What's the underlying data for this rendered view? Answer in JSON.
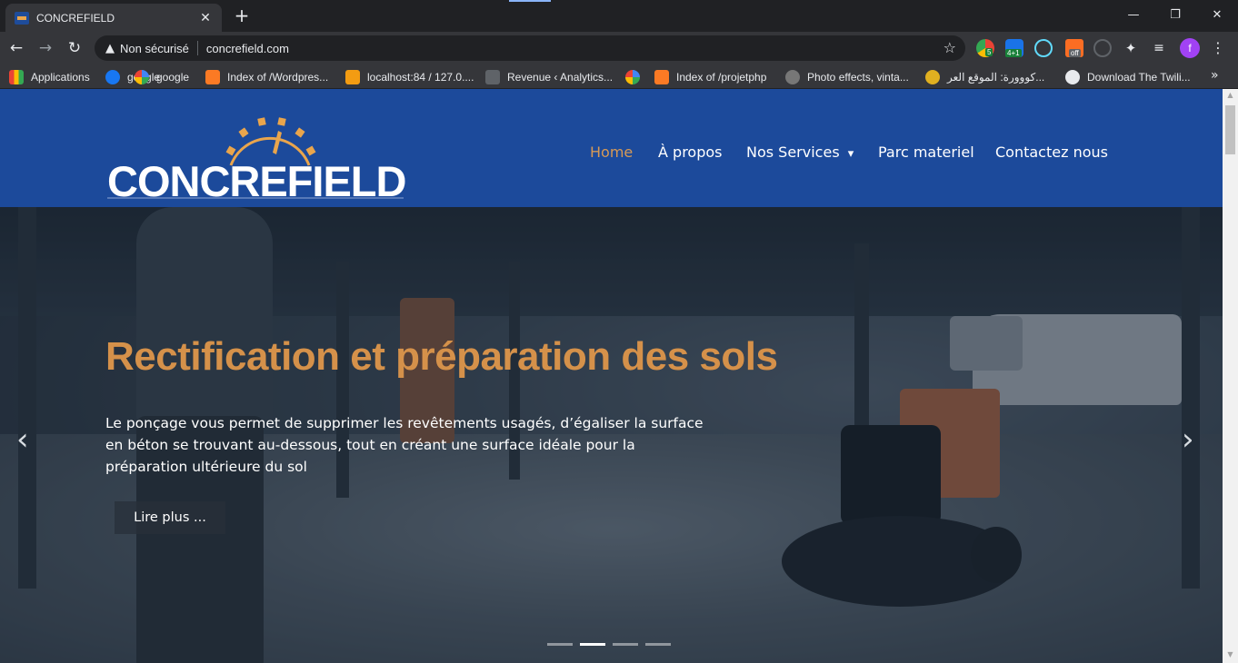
{
  "browser": {
    "tab": {
      "title": "CONCREFIELD",
      "close_glyph": "✕",
      "favicon": "concrefield-favicon"
    },
    "new_tab_glyph": "+",
    "window_controls": {
      "minimize": "—",
      "maximize": "❐",
      "close": "✕"
    },
    "toolbar": {
      "back_glyph": "←",
      "forward_glyph": "→",
      "reload_glyph": "↻",
      "security_label": "Non sécurisé",
      "url": "concrefield.com",
      "star_glyph": "☆",
      "ext_badges": [
        "5",
        "4+1",
        "off"
      ],
      "profile_initial": "f",
      "menu_glyph": "⋮"
    },
    "bookmarks": [
      {
        "label": "Applications",
        "icon": "apps-grid-icon",
        "color": "#e8453c"
      },
      {
        "label": "google",
        "icon": "facebook-icon",
        "color": "#1877f2"
      },
      {
        "label": "google",
        "icon": "google-icon",
        "color": "#ffffff"
      },
      {
        "label": "Index of /Wordpres...",
        "icon": "xampp-icon",
        "color": "#fb7a24"
      },
      {
        "label": "localhost:84 / 127.0....",
        "icon": "phpmyadmin-icon",
        "color": "#f39c12"
      },
      {
        "label": "Revenue ‹ Analytics...",
        "icon": "bag-icon",
        "color": "#5f6368"
      },
      {
        "label": "Index of /projetphp",
        "icon": "xampp-icon",
        "color": "#fb7a24"
      },
      {
        "label": "Photo effects, vinta...",
        "icon": "photo-icon",
        "color": "#777777"
      },
      {
        "label": "كووورة: الموقع العر...",
        "icon": "kooora-icon",
        "color": "#e0b020"
      },
      {
        "label": "Download The Twili...",
        "icon": "globe-icon",
        "color": "#e8eaed"
      }
    ],
    "bookmarks_more": "»"
  },
  "site": {
    "logo_text": "CONCREFIELD",
    "nav": [
      {
        "label": "Home",
        "active": true
      },
      {
        "label": "À propos",
        "active": false
      },
      {
        "label": "Nos Services",
        "active": false,
        "dropdown": true
      },
      {
        "label": "Parc materiel",
        "active": false
      },
      {
        "label": "Contactez nous",
        "active": false
      }
    ],
    "dropdown_glyph": "⌄",
    "hero": {
      "title": "Rectification et préparation des sols",
      "text": "Le ponçage vous permet de supprimer les revêtements usagés, d’égaliser la surface en béton se trouvant au-dessous, tout en créant une surface idéale pour la préparation ultérieure du sol",
      "button": "Lire plus ...",
      "prev_glyph": "‹",
      "next_glyph": "›",
      "slides": 4,
      "active_slide": 2
    }
  },
  "colors": {
    "header_blue": "#1c4a9b",
    "accent_orange": "#d5914a",
    "nav_active": "#d89a55"
  }
}
